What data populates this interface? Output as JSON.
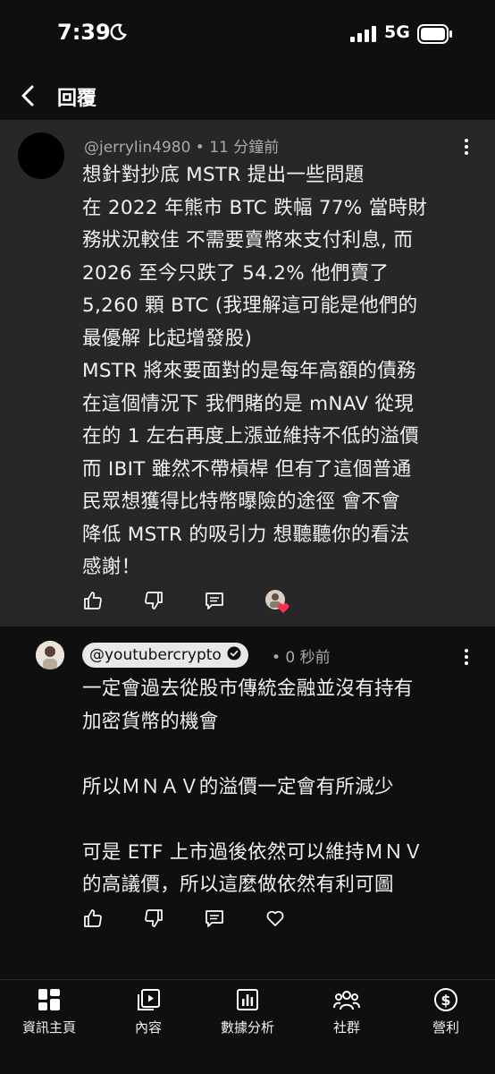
{
  "status_bar": {
    "time": "7:39",
    "network": "5G"
  },
  "header": {
    "title": "回覆"
  },
  "parent_comment": {
    "meta": "@jerrylin4980 • 11 分鐘前",
    "lines": [
      "想針對抄底 MSTR 提出一些問題",
      "在 2022 年熊市 BTC 跌幅 77% 當時財",
      "務狀況較佳 不需要賣幣來支付利息, 而",
      " 2026 至今只跌了 54.2% 他們賣了",
      " 5,260 顆 BTC (我理解這可能是他們的",
      "最優解 比起增發股)",
      "MSTR 將來要面對的是每年高額的債務",
      "在這個情況下 我們賭的是 mNAV 從現",
      "在的 1 左右再度上漲並維持不低的溢價",
      "而 IBIT 雖然不帶槓桿 但有了這個普通",
      "民眾想獲得比特幣曝險的途徑 會不會",
      "降低 MSTR 的吸引力 想聽聽你的看法",
      "感謝！"
    ]
  },
  "reply": {
    "author": "@youtubercrypto",
    "time": "• 0 秒前",
    "lines": [
      "一定會過去從股市傳統金融並沒有持有",
      "加密貨幣的機會",
      "",
      "所以ＭＮＡＶ的溢價一定會有所減少",
      "",
      "可是 ETF 上市過後依然可以維持ＭＮＶ",
      "的高議價，所以這麼做依然有利可圖"
    ]
  },
  "bottom_nav": {
    "items": [
      {
        "label": "資訊主頁",
        "icon": "dashboard-icon"
      },
      {
        "label": "內容",
        "icon": "content-icon"
      },
      {
        "label": "數據分析",
        "icon": "analytics-icon"
      },
      {
        "label": "社群",
        "icon": "community-icon"
      },
      {
        "label": "營利",
        "icon": "earn-icon"
      }
    ]
  }
}
